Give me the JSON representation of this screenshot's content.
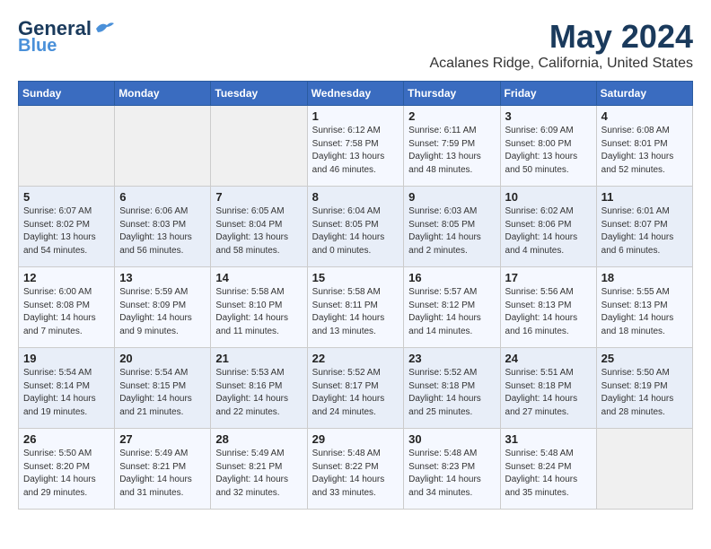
{
  "logo": {
    "line1": "General",
    "line2": "Blue"
  },
  "title": "May 2024",
  "location": "Acalanes Ridge, California, United States",
  "weekdays": [
    "Sunday",
    "Monday",
    "Tuesday",
    "Wednesday",
    "Thursday",
    "Friday",
    "Saturday"
  ],
  "weeks": [
    [
      {
        "day": "",
        "sunrise": "",
        "sunset": "",
        "daylight": ""
      },
      {
        "day": "",
        "sunrise": "",
        "sunset": "",
        "daylight": ""
      },
      {
        "day": "",
        "sunrise": "",
        "sunset": "",
        "daylight": ""
      },
      {
        "day": "1",
        "sunrise": "Sunrise: 6:12 AM",
        "sunset": "Sunset: 7:58 PM",
        "daylight": "Daylight: 13 hours and 46 minutes."
      },
      {
        "day": "2",
        "sunrise": "Sunrise: 6:11 AM",
        "sunset": "Sunset: 7:59 PM",
        "daylight": "Daylight: 13 hours and 48 minutes."
      },
      {
        "day": "3",
        "sunrise": "Sunrise: 6:09 AM",
        "sunset": "Sunset: 8:00 PM",
        "daylight": "Daylight: 13 hours and 50 minutes."
      },
      {
        "day": "4",
        "sunrise": "Sunrise: 6:08 AM",
        "sunset": "Sunset: 8:01 PM",
        "daylight": "Daylight: 13 hours and 52 minutes."
      }
    ],
    [
      {
        "day": "5",
        "sunrise": "Sunrise: 6:07 AM",
        "sunset": "Sunset: 8:02 PM",
        "daylight": "Daylight: 13 hours and 54 minutes."
      },
      {
        "day": "6",
        "sunrise": "Sunrise: 6:06 AM",
        "sunset": "Sunset: 8:03 PM",
        "daylight": "Daylight: 13 hours and 56 minutes."
      },
      {
        "day": "7",
        "sunrise": "Sunrise: 6:05 AM",
        "sunset": "Sunset: 8:04 PM",
        "daylight": "Daylight: 13 hours and 58 minutes."
      },
      {
        "day": "8",
        "sunrise": "Sunrise: 6:04 AM",
        "sunset": "Sunset: 8:05 PM",
        "daylight": "Daylight: 14 hours and 0 minutes."
      },
      {
        "day": "9",
        "sunrise": "Sunrise: 6:03 AM",
        "sunset": "Sunset: 8:05 PM",
        "daylight": "Daylight: 14 hours and 2 minutes."
      },
      {
        "day": "10",
        "sunrise": "Sunrise: 6:02 AM",
        "sunset": "Sunset: 8:06 PM",
        "daylight": "Daylight: 14 hours and 4 minutes."
      },
      {
        "day": "11",
        "sunrise": "Sunrise: 6:01 AM",
        "sunset": "Sunset: 8:07 PM",
        "daylight": "Daylight: 14 hours and 6 minutes."
      }
    ],
    [
      {
        "day": "12",
        "sunrise": "Sunrise: 6:00 AM",
        "sunset": "Sunset: 8:08 PM",
        "daylight": "Daylight: 14 hours and 7 minutes."
      },
      {
        "day": "13",
        "sunrise": "Sunrise: 5:59 AM",
        "sunset": "Sunset: 8:09 PM",
        "daylight": "Daylight: 14 hours and 9 minutes."
      },
      {
        "day": "14",
        "sunrise": "Sunrise: 5:58 AM",
        "sunset": "Sunset: 8:10 PM",
        "daylight": "Daylight: 14 hours and 11 minutes."
      },
      {
        "day": "15",
        "sunrise": "Sunrise: 5:58 AM",
        "sunset": "Sunset: 8:11 PM",
        "daylight": "Daylight: 14 hours and 13 minutes."
      },
      {
        "day": "16",
        "sunrise": "Sunrise: 5:57 AM",
        "sunset": "Sunset: 8:12 PM",
        "daylight": "Daylight: 14 hours and 14 minutes."
      },
      {
        "day": "17",
        "sunrise": "Sunrise: 5:56 AM",
        "sunset": "Sunset: 8:13 PM",
        "daylight": "Daylight: 14 hours and 16 minutes."
      },
      {
        "day": "18",
        "sunrise": "Sunrise: 5:55 AM",
        "sunset": "Sunset: 8:13 PM",
        "daylight": "Daylight: 14 hours and 18 minutes."
      }
    ],
    [
      {
        "day": "19",
        "sunrise": "Sunrise: 5:54 AM",
        "sunset": "Sunset: 8:14 PM",
        "daylight": "Daylight: 14 hours and 19 minutes."
      },
      {
        "day": "20",
        "sunrise": "Sunrise: 5:54 AM",
        "sunset": "Sunset: 8:15 PM",
        "daylight": "Daylight: 14 hours and 21 minutes."
      },
      {
        "day": "21",
        "sunrise": "Sunrise: 5:53 AM",
        "sunset": "Sunset: 8:16 PM",
        "daylight": "Daylight: 14 hours and 22 minutes."
      },
      {
        "day": "22",
        "sunrise": "Sunrise: 5:52 AM",
        "sunset": "Sunset: 8:17 PM",
        "daylight": "Daylight: 14 hours and 24 minutes."
      },
      {
        "day": "23",
        "sunrise": "Sunrise: 5:52 AM",
        "sunset": "Sunset: 8:18 PM",
        "daylight": "Daylight: 14 hours and 25 minutes."
      },
      {
        "day": "24",
        "sunrise": "Sunrise: 5:51 AM",
        "sunset": "Sunset: 8:18 PM",
        "daylight": "Daylight: 14 hours and 27 minutes."
      },
      {
        "day": "25",
        "sunrise": "Sunrise: 5:50 AM",
        "sunset": "Sunset: 8:19 PM",
        "daylight": "Daylight: 14 hours and 28 minutes."
      }
    ],
    [
      {
        "day": "26",
        "sunrise": "Sunrise: 5:50 AM",
        "sunset": "Sunset: 8:20 PM",
        "daylight": "Daylight: 14 hours and 29 minutes."
      },
      {
        "day": "27",
        "sunrise": "Sunrise: 5:49 AM",
        "sunset": "Sunset: 8:21 PM",
        "daylight": "Daylight: 14 hours and 31 minutes."
      },
      {
        "day": "28",
        "sunrise": "Sunrise: 5:49 AM",
        "sunset": "Sunset: 8:21 PM",
        "daylight": "Daylight: 14 hours and 32 minutes."
      },
      {
        "day": "29",
        "sunrise": "Sunrise: 5:48 AM",
        "sunset": "Sunset: 8:22 PM",
        "daylight": "Daylight: 14 hours and 33 minutes."
      },
      {
        "day": "30",
        "sunrise": "Sunrise: 5:48 AM",
        "sunset": "Sunset: 8:23 PM",
        "daylight": "Daylight: 14 hours and 34 minutes."
      },
      {
        "day": "31",
        "sunrise": "Sunrise: 5:48 AM",
        "sunset": "Sunset: 8:24 PM",
        "daylight": "Daylight: 14 hours and 35 minutes."
      },
      {
        "day": "",
        "sunrise": "",
        "sunset": "",
        "daylight": ""
      }
    ]
  ]
}
